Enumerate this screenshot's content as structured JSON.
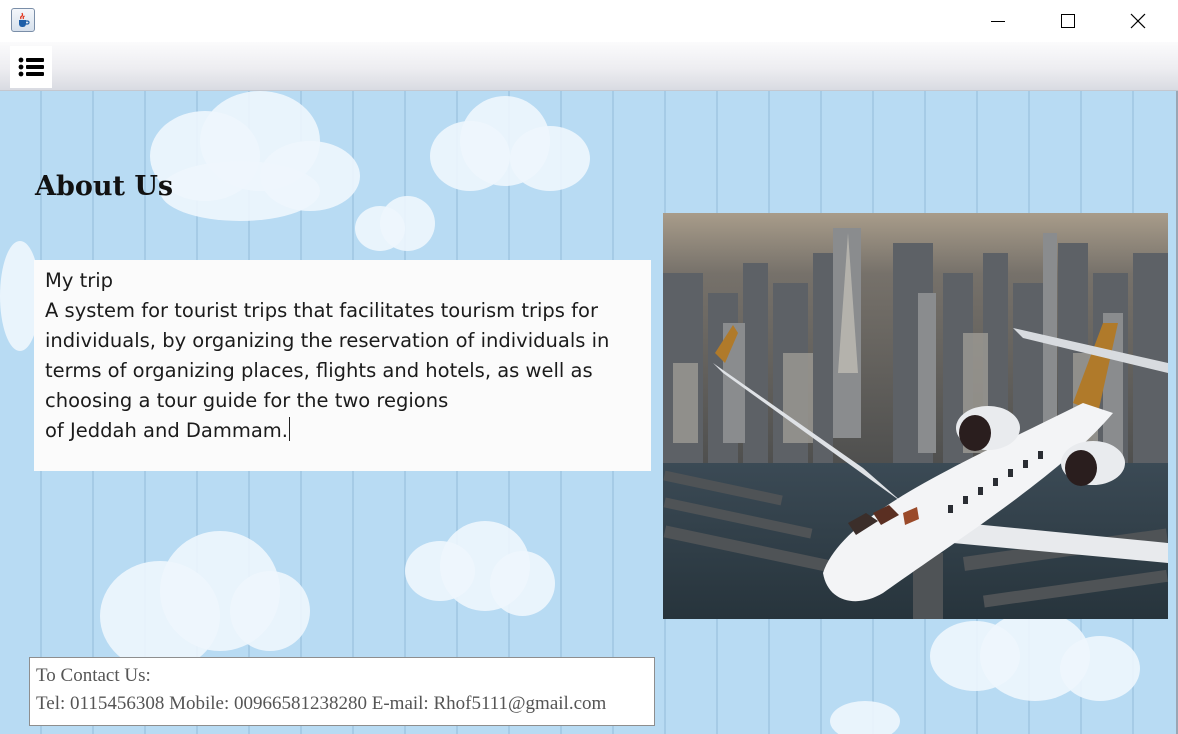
{
  "window": {
    "app_icon": "java-cup-icon",
    "controls": [
      "minimize-icon",
      "maximize-icon",
      "close-icon"
    ]
  },
  "toolbar": {
    "menu_icon": "list-icon"
  },
  "about": {
    "heading": "About Us",
    "lines": [
      "My trip",
      "A system for tourist trips that facilitates tourism trips for",
      "individuals, by organizing the reservation of individuals in",
      "terms of organizing places, flights and hotels, as well as",
      "choosing a tour guide for the two regions",
      "of Jeddah and Dammam."
    ]
  },
  "image": {
    "subject": "airplane-over-city-photo"
  },
  "contact": {
    "title": "To Contact Us:",
    "details": "Tel: 0115456308  Mobile: 00966581238280  E-mail: Rhof5111@gmail.com"
  },
  "colors": {
    "background": "#b8dbf3",
    "cloud": "#eef6fd",
    "text": "#1b1b1b",
    "contact_text": "#555555"
  }
}
